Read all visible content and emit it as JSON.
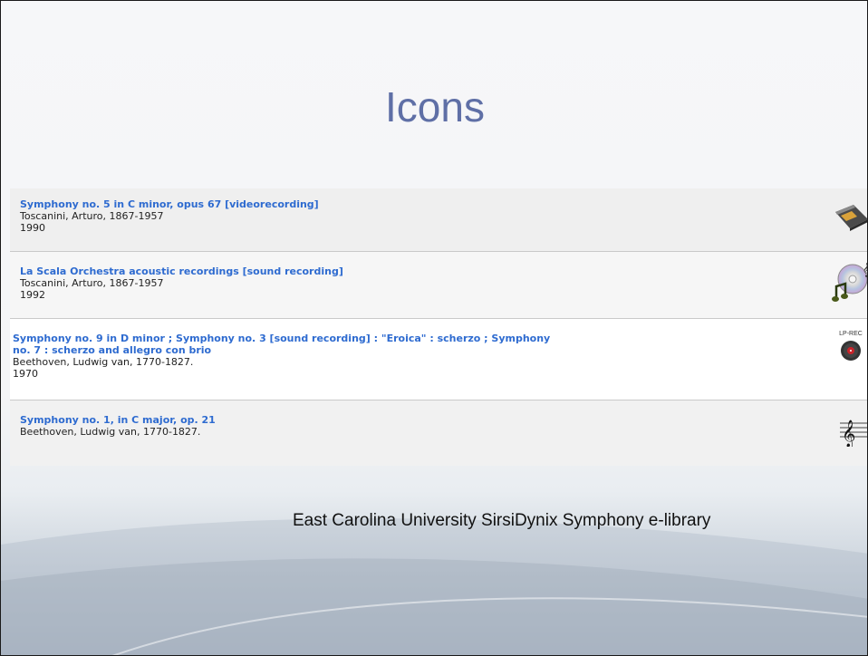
{
  "slide": {
    "title": "Icons",
    "footer": "East Carolina University SirsiDynix Symphony e-library"
  },
  "results": [
    {
      "title": "Symphony no. 5 in C minor, opus 67 [videorecording]",
      "author": "Toscanini, Arturo, 1867-1957",
      "year": "1990",
      "icon": "videocassette-icon"
    },
    {
      "title": "La Scala Orchestra acoustic recordings [sound recording]",
      "author": "Toscanini, Arturo, 1867-1957",
      "year": "1992",
      "icon": "cd-sound-recording-icon"
    },
    {
      "title_line1": "Symphony no. 9 in D minor ; Symphony no. 3 [sound recording] : \"Eroica\" : scherzo ; Symphony",
      "title_line2": "no. 7 : scherzo and allegro con brio",
      "author": "Beethoven, Ludwig van, 1770-1827.",
      "year": "1970",
      "icon": "lp-record-icon",
      "icon_label": "LP-REC"
    },
    {
      "title": "Symphony no. 1, in C major, op. 21",
      "author": "Beethoven, Ludwig van, 1770-1827.",
      "icon": "music-score-icon"
    }
  ]
}
